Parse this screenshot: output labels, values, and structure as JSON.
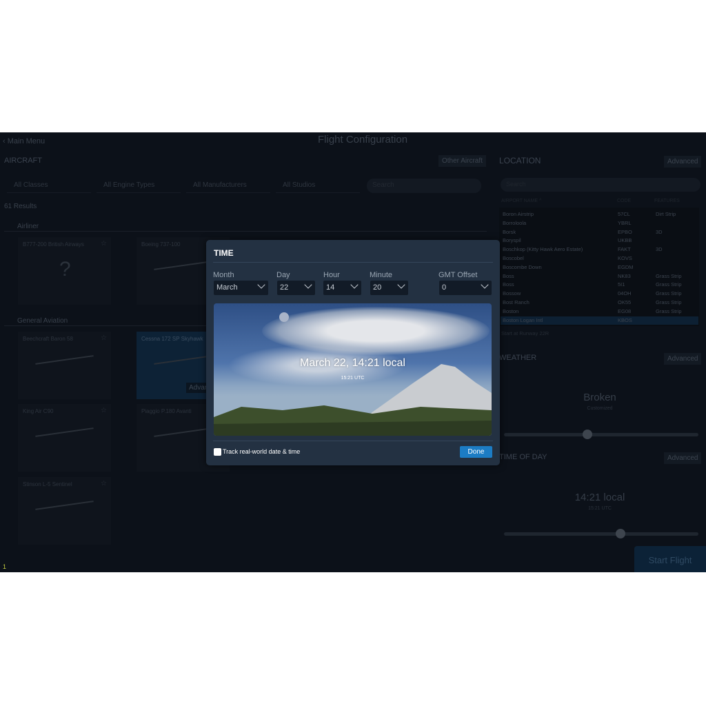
{
  "header": {
    "back_label": "Main Menu",
    "title": "Flight Configuration"
  },
  "aircraft": {
    "title": "AIRCRAFT",
    "other_button": "Other Aircraft",
    "filters": [
      "All Classes",
      "All Engine Types",
      "All Manufacturers",
      "All Studios"
    ],
    "search_placeholder": "Search",
    "results": "61 Results",
    "groups": [
      {
        "label": "Airliner"
      },
      {
        "label": "General Aviation"
      }
    ],
    "cards": [
      {
        "name": "B777-200 British Airways"
      },
      {
        "name": "Boeing 737-100"
      },
      {
        "name": "Beechcraft Baron 58"
      },
      {
        "name": "Cessna 172 SP Skyhawk"
      },
      {
        "name": "King Air C90"
      },
      {
        "name": "Piaggio P.180 Avanti"
      },
      {
        "name": "Stinson L-5 Sentinel"
      }
    ],
    "unknown_glyph": "?",
    "selected_advanced": "Advanced"
  },
  "location": {
    "title": "LOCATION",
    "advanced": "Advanced",
    "search_placeholder": "Search",
    "columns": [
      "AIRPORT NAME ^",
      "CODE",
      "FEATURES"
    ],
    "rows": [
      [
        "Boron Airstrip",
        "57CL",
        "Dirt Strip"
      ],
      [
        "Borroloola",
        "YBRL",
        ""
      ],
      [
        "Borsk",
        "EPBO",
        "3D"
      ],
      [
        "Boryspil",
        "UKBB",
        ""
      ],
      [
        "Boschkop (Kitty Hawk Aero Estate)",
        "FAKT",
        "3D"
      ],
      [
        "Boscobel",
        "KOVS",
        ""
      ],
      [
        "Boscombe Down",
        "EGDM",
        ""
      ],
      [
        "Boss",
        "NK83",
        "Grass Strip"
      ],
      [
        "Boss",
        "5I1",
        "Grass Strip"
      ],
      [
        "Bossow",
        "04OH",
        "Grass Strip"
      ],
      [
        "Bost Ranch",
        "OK55",
        "Grass Strip"
      ],
      [
        "Boston",
        "EG08",
        "Grass Strip"
      ],
      [
        "Boston Logan Intl",
        "KBOS",
        ""
      ]
    ],
    "start_at": "Start at Runway 22R"
  },
  "weather": {
    "title": "WEATHER",
    "advanced": "Advanced",
    "condition": "Broken",
    "sub": "Customized",
    "slider_fraction": 0.43
  },
  "time_of_day": {
    "title": "TIME OF DAY",
    "advanced": "Advanced",
    "local": "14:21 local",
    "utc": "15:21 UTC",
    "slider_fraction": 0.6
  },
  "start_flight": "Start Flight",
  "corner_number": "1",
  "dialog": {
    "title": "TIME",
    "fields": [
      {
        "label": "Month",
        "value": "March"
      },
      {
        "label": "Day",
        "value": "22"
      },
      {
        "label": "Hour",
        "value": "14"
      },
      {
        "label": "Minute",
        "value": "20"
      },
      {
        "label": "GMT Offset",
        "value": "0"
      }
    ],
    "preview_main": "March 22, 14:21 local",
    "preview_sub": "15:21 UTC",
    "track_label": "Track real-world date & time",
    "track_checked": false,
    "done": "Done"
  },
  "colors": {
    "accent": "#1c7cc4",
    "dialog_bg": "#233142",
    "app_bg": "#0c1119"
  }
}
